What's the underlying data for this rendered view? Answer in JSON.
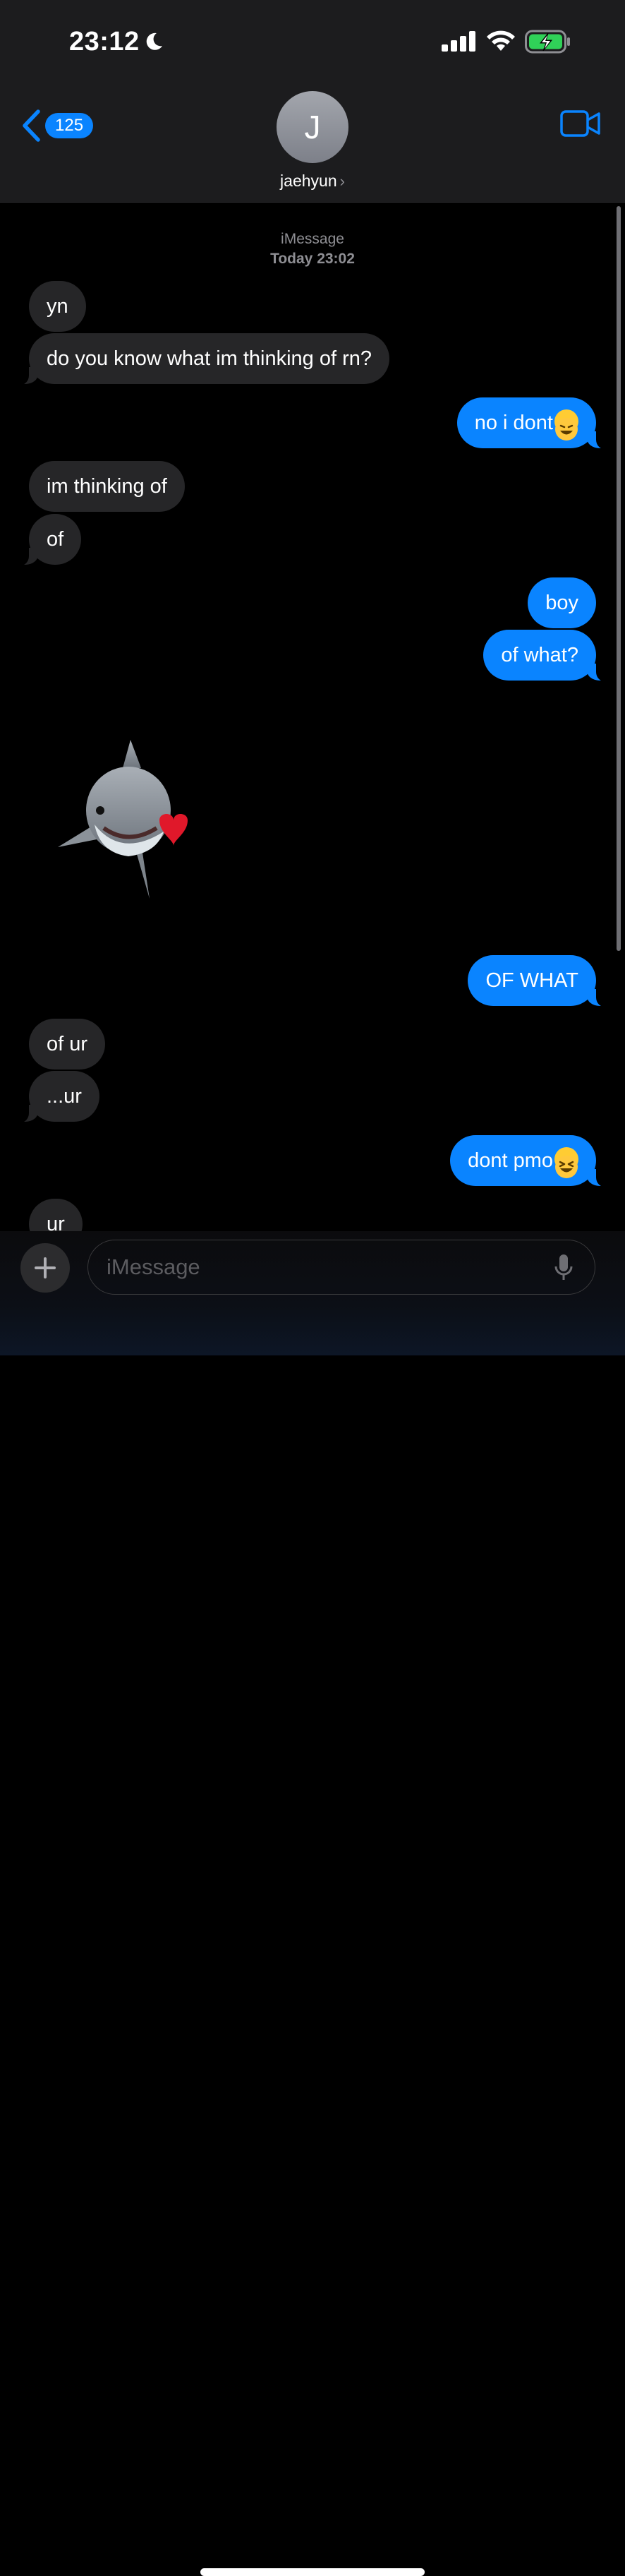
{
  "status_bar": {
    "time": "23:12"
  },
  "header": {
    "back_count": "125",
    "avatar_initial": "J",
    "contact_name": "jaehyun"
  },
  "thread": {
    "service": "iMessage",
    "timestamp": "Today 23:02",
    "messages": [
      {
        "from": "them",
        "text": "yn"
      },
      {
        "from": "them",
        "text": "do you know what im thinking of rn?"
      },
      {
        "from": "me",
        "text": "no i dont",
        "emoji": "rolling-on-the-floor-laughing"
      },
      {
        "from": "them",
        "text": "im thinking of"
      },
      {
        "from": "them",
        "text": "of"
      },
      {
        "from": "me",
        "text": "boy"
      },
      {
        "from": "me",
        "text": "of what?"
      },
      {
        "from": "them",
        "sticker": "shark-memoji-with-heart"
      },
      {
        "from": "me",
        "text": "OF WHAT"
      },
      {
        "from": "them",
        "text": "of ur"
      },
      {
        "from": "them",
        "text": "...ur"
      },
      {
        "from": "me",
        "text": "dont pmo",
        "emoji": "grinning-squinting-face"
      },
      {
        "from": "them",
        "text": "ur"
      }
    ]
  },
  "composer": {
    "placeholder": "iMessage"
  },
  "colors": {
    "accent": "#0a84ff",
    "incoming_bubble": "#262628",
    "background": "#000000"
  }
}
